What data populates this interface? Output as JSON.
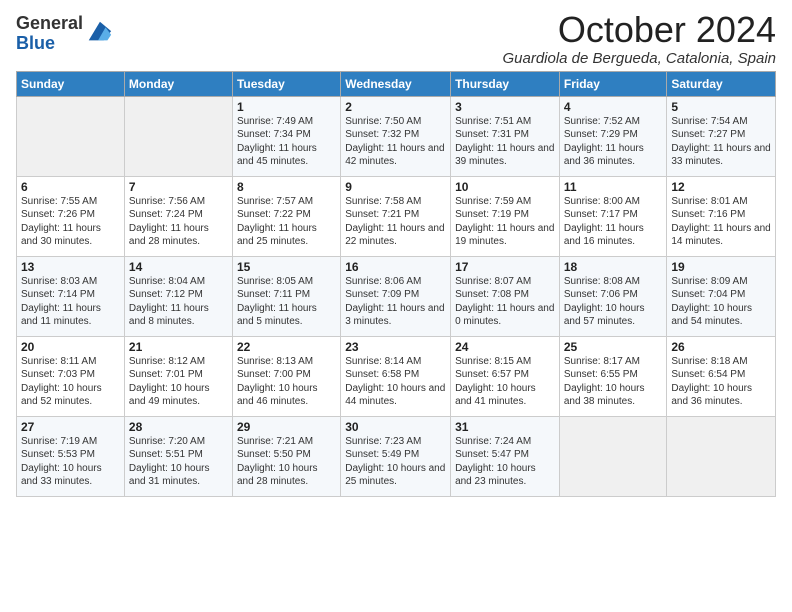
{
  "logo": {
    "general": "General",
    "blue": "Blue"
  },
  "title": "October 2024",
  "location": "Guardiola de Bergueda, Catalonia, Spain",
  "days_of_week": [
    "Sunday",
    "Monday",
    "Tuesday",
    "Wednesday",
    "Thursday",
    "Friday",
    "Saturday"
  ],
  "weeks": [
    [
      {
        "day": "",
        "info": ""
      },
      {
        "day": "",
        "info": ""
      },
      {
        "day": "1",
        "info": "Sunrise: 7:49 AM\nSunset: 7:34 PM\nDaylight: 11 hours and 45 minutes."
      },
      {
        "day": "2",
        "info": "Sunrise: 7:50 AM\nSunset: 7:32 PM\nDaylight: 11 hours and 42 minutes."
      },
      {
        "day": "3",
        "info": "Sunrise: 7:51 AM\nSunset: 7:31 PM\nDaylight: 11 hours and 39 minutes."
      },
      {
        "day": "4",
        "info": "Sunrise: 7:52 AM\nSunset: 7:29 PM\nDaylight: 11 hours and 36 minutes."
      },
      {
        "day": "5",
        "info": "Sunrise: 7:54 AM\nSunset: 7:27 PM\nDaylight: 11 hours and 33 minutes."
      }
    ],
    [
      {
        "day": "6",
        "info": "Sunrise: 7:55 AM\nSunset: 7:26 PM\nDaylight: 11 hours and 30 minutes."
      },
      {
        "day": "7",
        "info": "Sunrise: 7:56 AM\nSunset: 7:24 PM\nDaylight: 11 hours and 28 minutes."
      },
      {
        "day": "8",
        "info": "Sunrise: 7:57 AM\nSunset: 7:22 PM\nDaylight: 11 hours and 25 minutes."
      },
      {
        "day": "9",
        "info": "Sunrise: 7:58 AM\nSunset: 7:21 PM\nDaylight: 11 hours and 22 minutes."
      },
      {
        "day": "10",
        "info": "Sunrise: 7:59 AM\nSunset: 7:19 PM\nDaylight: 11 hours and 19 minutes."
      },
      {
        "day": "11",
        "info": "Sunrise: 8:00 AM\nSunset: 7:17 PM\nDaylight: 11 hours and 16 minutes."
      },
      {
        "day": "12",
        "info": "Sunrise: 8:01 AM\nSunset: 7:16 PM\nDaylight: 11 hours and 14 minutes."
      }
    ],
    [
      {
        "day": "13",
        "info": "Sunrise: 8:03 AM\nSunset: 7:14 PM\nDaylight: 11 hours and 11 minutes."
      },
      {
        "day": "14",
        "info": "Sunrise: 8:04 AM\nSunset: 7:12 PM\nDaylight: 11 hours and 8 minutes."
      },
      {
        "day": "15",
        "info": "Sunrise: 8:05 AM\nSunset: 7:11 PM\nDaylight: 11 hours and 5 minutes."
      },
      {
        "day": "16",
        "info": "Sunrise: 8:06 AM\nSunset: 7:09 PM\nDaylight: 11 hours and 3 minutes."
      },
      {
        "day": "17",
        "info": "Sunrise: 8:07 AM\nSunset: 7:08 PM\nDaylight: 11 hours and 0 minutes."
      },
      {
        "day": "18",
        "info": "Sunrise: 8:08 AM\nSunset: 7:06 PM\nDaylight: 10 hours and 57 minutes."
      },
      {
        "day": "19",
        "info": "Sunrise: 8:09 AM\nSunset: 7:04 PM\nDaylight: 10 hours and 54 minutes."
      }
    ],
    [
      {
        "day": "20",
        "info": "Sunrise: 8:11 AM\nSunset: 7:03 PM\nDaylight: 10 hours and 52 minutes."
      },
      {
        "day": "21",
        "info": "Sunrise: 8:12 AM\nSunset: 7:01 PM\nDaylight: 10 hours and 49 minutes."
      },
      {
        "day": "22",
        "info": "Sunrise: 8:13 AM\nSunset: 7:00 PM\nDaylight: 10 hours and 46 minutes."
      },
      {
        "day": "23",
        "info": "Sunrise: 8:14 AM\nSunset: 6:58 PM\nDaylight: 10 hours and 44 minutes."
      },
      {
        "day": "24",
        "info": "Sunrise: 8:15 AM\nSunset: 6:57 PM\nDaylight: 10 hours and 41 minutes."
      },
      {
        "day": "25",
        "info": "Sunrise: 8:17 AM\nSunset: 6:55 PM\nDaylight: 10 hours and 38 minutes."
      },
      {
        "day": "26",
        "info": "Sunrise: 8:18 AM\nSunset: 6:54 PM\nDaylight: 10 hours and 36 minutes."
      }
    ],
    [
      {
        "day": "27",
        "info": "Sunrise: 7:19 AM\nSunset: 5:53 PM\nDaylight: 10 hours and 33 minutes."
      },
      {
        "day": "28",
        "info": "Sunrise: 7:20 AM\nSunset: 5:51 PM\nDaylight: 10 hours and 31 minutes."
      },
      {
        "day": "29",
        "info": "Sunrise: 7:21 AM\nSunset: 5:50 PM\nDaylight: 10 hours and 28 minutes."
      },
      {
        "day": "30",
        "info": "Sunrise: 7:23 AM\nSunset: 5:49 PM\nDaylight: 10 hours and 25 minutes."
      },
      {
        "day": "31",
        "info": "Sunrise: 7:24 AM\nSunset: 5:47 PM\nDaylight: 10 hours and 23 minutes."
      },
      {
        "day": "",
        "info": ""
      },
      {
        "day": "",
        "info": ""
      }
    ]
  ]
}
